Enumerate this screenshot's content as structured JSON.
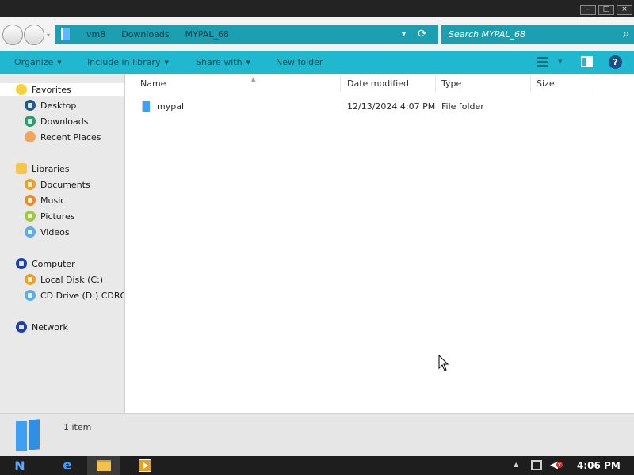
{
  "window": {
    "controls": {
      "minimize": "–",
      "maximize": "□",
      "close": "×"
    }
  },
  "address": {
    "crumbs": [
      "vm8",
      "Downloads",
      "MYPAL_68"
    ],
    "dropdown_glyph": "▾",
    "refresh_glyph": "⟳"
  },
  "search": {
    "placeholder": "Search MYPAL_68",
    "icon": "search-icon"
  },
  "toolbar": {
    "organize": "Organize",
    "include_in_library": "Include in library",
    "share_with": "Share with",
    "new_folder": "New folder",
    "help": "?"
  },
  "sidebar": {
    "groups": [
      {
        "label": "Favorites",
        "icon": "star-icon",
        "color": "#f6d23a",
        "items": [
          {
            "label": "Desktop",
            "icon": "desktop-icon",
            "color": "#1e5a8c"
          },
          {
            "label": "Downloads",
            "icon": "downloads-icon",
            "color": "#2a9d6f"
          },
          {
            "label": "Recent Places",
            "icon": "recent-places-icon",
            "color": "#f2a65a"
          }
        ]
      },
      {
        "label": "Libraries",
        "icon": "libraries-icon",
        "color": "#f6c64a",
        "items": [
          {
            "label": "Documents",
            "icon": "documents-icon",
            "color": "#f0a020"
          },
          {
            "label": "Music",
            "icon": "music-icon",
            "color": "#f08a20"
          },
          {
            "label": "Pictures",
            "icon": "pictures-icon",
            "color": "#9ccc3a"
          },
          {
            "label": "Videos",
            "icon": "videos-icon",
            "color": "#5aaee8"
          }
        ]
      },
      {
        "label": "Computer",
        "icon": "computer-icon",
        "color": "#1a3fb0",
        "items": [
          {
            "label": "Local Disk (C:)",
            "icon": "local-disk-icon",
            "color": "#f0a020"
          },
          {
            "label": "CD Drive (D:) CDROM",
            "icon": "cd-drive-icon",
            "color": "#5aaee8"
          }
        ]
      },
      {
        "label": "Network",
        "icon": "network-icon",
        "color": "#1a3fb0",
        "items": []
      }
    ]
  },
  "columns": {
    "name": "Name",
    "date_modified": "Date modified",
    "type": "Type",
    "size": "Size"
  },
  "files": [
    {
      "name": "mypal",
      "date_modified": "12/13/2024 4:07 PM",
      "type": "File folder",
      "size": "",
      "icon": "folder-icon"
    }
  ],
  "details": {
    "count": "1 item"
  },
  "taskbar": {
    "clock": "4:06 PM",
    "start_glyph": "N",
    "ie_glyph": "e",
    "tray_arrow": "▲",
    "volume_glyph": "◀",
    "volume_muted_mark": "x"
  },
  "colors": {
    "accent": "#1fb8cf",
    "address_bg": "#1c9fb0",
    "taskbar": "#1e1e1e"
  }
}
